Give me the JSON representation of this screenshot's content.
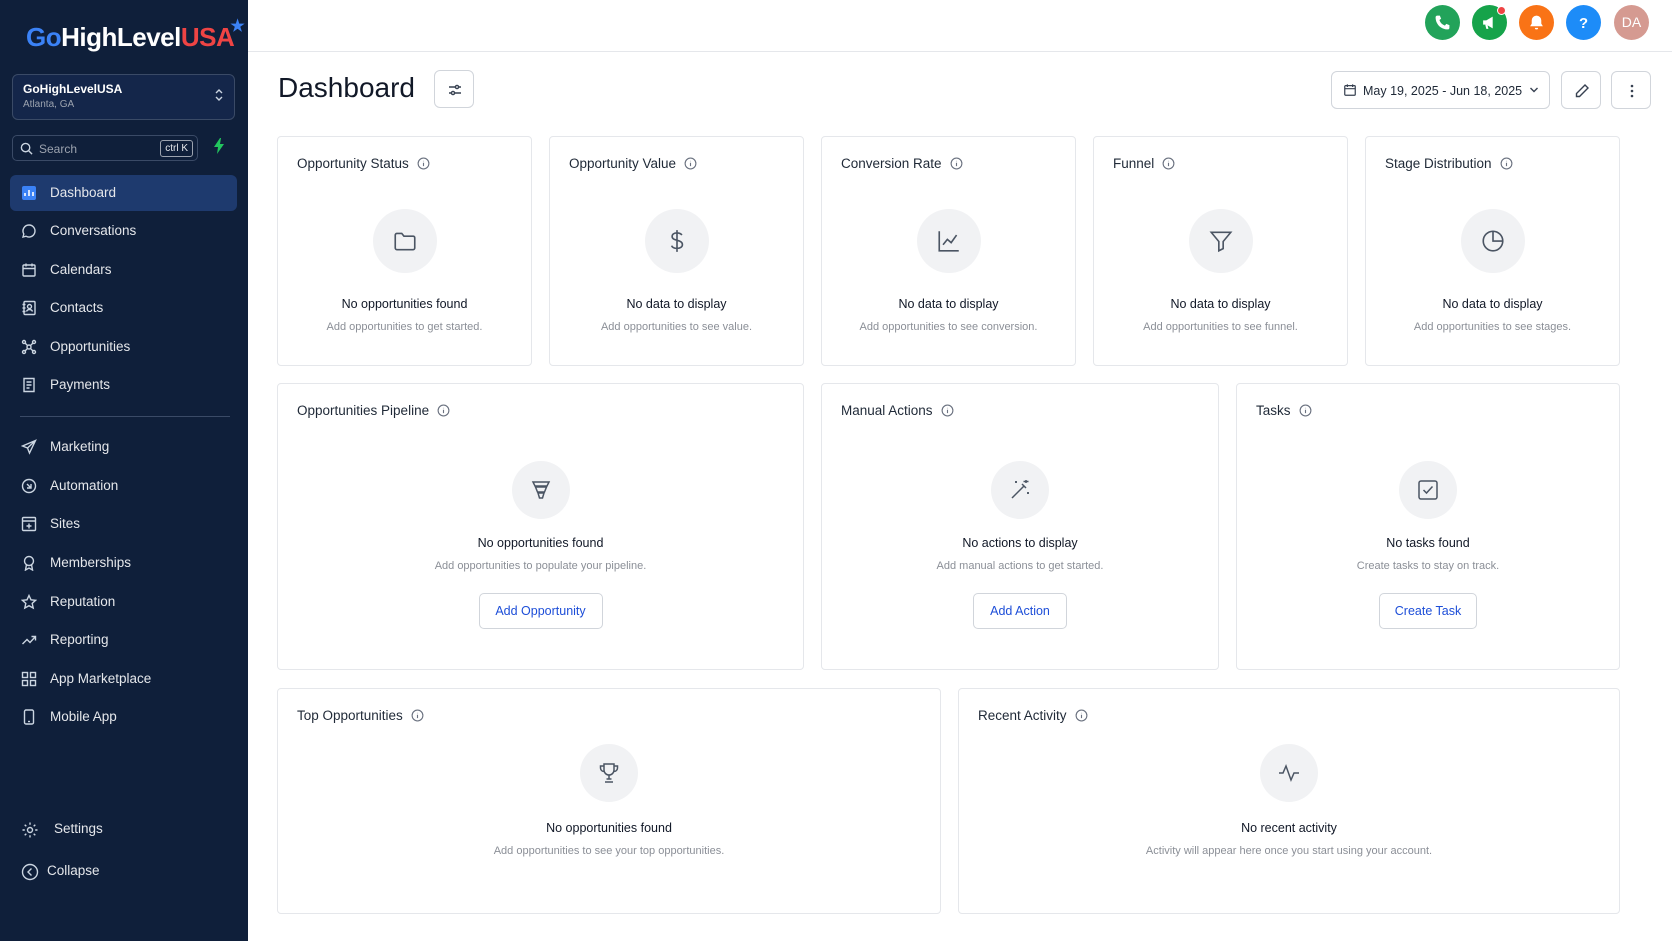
{
  "brand": {
    "go": "Go",
    "highlevel": "HighLevel",
    "usa": "USA"
  },
  "account": {
    "name": "GoHighLevelUSA",
    "location": "Atlanta, GA"
  },
  "search": {
    "placeholder": "Search",
    "shortcut": "ctrl K"
  },
  "sidebar": {
    "items": [
      {
        "label": "Dashboard",
        "icon": "dashboard-icon",
        "active": true
      },
      {
        "label": "Conversations",
        "icon": "chat-bubble-icon"
      },
      {
        "label": "Calendars",
        "icon": "calendar-icon"
      },
      {
        "label": "Contacts",
        "icon": "contact-book-icon"
      },
      {
        "label": "Opportunities",
        "icon": "opportunities-icon"
      },
      {
        "label": "Payments",
        "icon": "receipt-icon"
      },
      {
        "label": "Marketing",
        "icon": "send-icon"
      },
      {
        "label": "Automation",
        "icon": "automation-icon"
      },
      {
        "label": "Sites",
        "icon": "sites-icon"
      },
      {
        "label": "Memberships",
        "icon": "award-icon"
      },
      {
        "label": "Reputation",
        "icon": "star-icon"
      },
      {
        "label": "Reporting",
        "icon": "trend-up-icon"
      },
      {
        "label": "App Marketplace",
        "icon": "grid-icon"
      },
      {
        "label": "Mobile App",
        "icon": "mobile-icon"
      }
    ],
    "settings": "Settings",
    "collapse": "Collapse"
  },
  "topbar": {
    "avatar_initials": "DA",
    "colors": {
      "phone": "#22a35a",
      "announce": "#16a34a",
      "notify": "#f97316",
      "help": "#1d8cf8"
    }
  },
  "header": {
    "title": "Dashboard",
    "date_range": "May 19, 2025 - Jun 18, 2025"
  },
  "cards": {
    "opp_status": {
      "title": "Opportunity Status",
      "empty": "No opportunities found",
      "hint": "Add opportunities to get started.",
      "icon": "folder-icon"
    },
    "opp_value": {
      "title": "Opportunity Value",
      "empty": "No data to display",
      "hint": "Add opportunities to see value.",
      "icon": "dollar-icon"
    },
    "conversion": {
      "title": "Conversion Rate",
      "empty": "No data to display",
      "hint": "Add opportunities to see conversion.",
      "icon": "line-chart-icon"
    },
    "funnel": {
      "title": "Funnel",
      "empty": "No data to display",
      "hint": "Add opportunities to see funnel.",
      "icon": "funnel-icon"
    },
    "stage_dist": {
      "title": "Stage Distribution",
      "empty": "No data to display",
      "hint": "Add opportunities to see stages.",
      "icon": "pie-chart-icon"
    },
    "pipeline": {
      "title": "Opportunities Pipeline",
      "empty": "No opportunities found",
      "hint": "Add opportunities to populate your pipeline.",
      "button": "Add Opportunity",
      "icon": "pipeline-icon"
    },
    "manual": {
      "title": "Manual Actions",
      "empty": "No actions to display",
      "hint": "Add manual actions to get started.",
      "button": "Add Action",
      "icon": "magic-wand-icon"
    },
    "tasks": {
      "title": "Tasks",
      "empty": "No tasks found",
      "hint": "Create tasks to stay on track.",
      "button": "Create Task",
      "icon": "checkbox-icon"
    },
    "top_opps": {
      "title": "Top Opportunities",
      "empty": "No opportunities found",
      "hint": "Add opportunities to see your top opportunities.",
      "icon": "trophy-icon"
    },
    "recent": {
      "title": "Recent Activity",
      "empty": "No recent activity",
      "hint": "Activity will appear here once you start using your account.",
      "icon": "activity-icon"
    }
  }
}
